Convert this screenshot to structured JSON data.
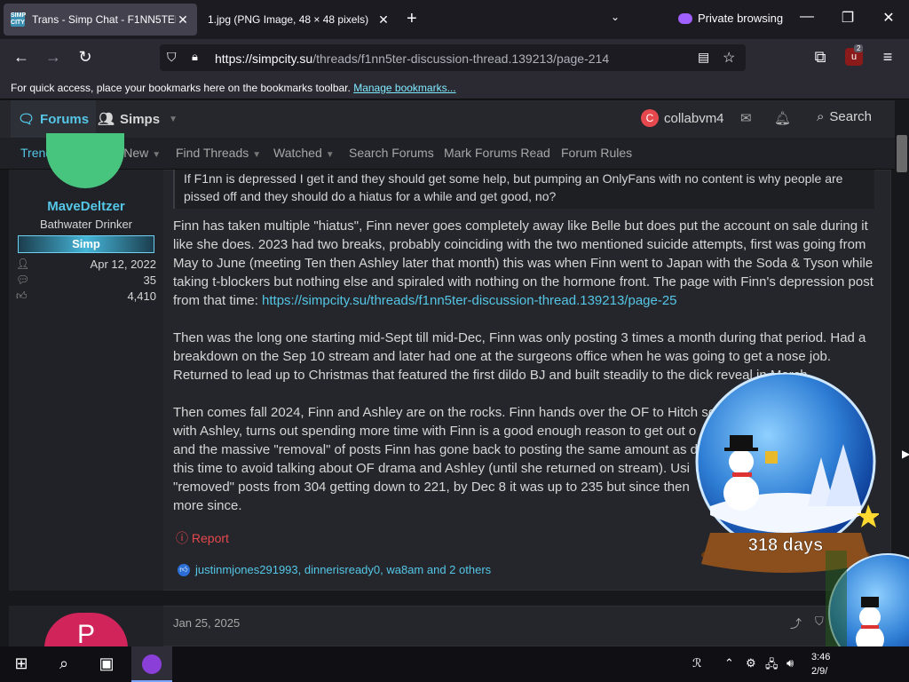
{
  "colors": {
    "accent": "#55c6e6",
    "report": "#e5484d",
    "private": "#a060ff"
  },
  "browser": {
    "tabs": [
      {
        "title": "Trans - Simp Chat - F1NN5TER",
        "favicon": "simpcity-favicon",
        "active": true
      },
      {
        "title": "1.jpg (PNG Image, 48 × 48 pixels)",
        "favicon": "image-favicon",
        "active": false
      }
    ],
    "new_tab": "+",
    "private_label": "Private browsing",
    "url": {
      "host": "https://simpcity.su",
      "path": "/threads/f1nn5ter-discussion-thread.139213/page-214"
    },
    "extension_badge": "2",
    "bookmarks_text": "For quick access, place your bookmarks here on the bookmarks toolbar.",
    "bookmarks_link": "Manage bookmarks..."
  },
  "site": {
    "forums_label": "Forums",
    "simps_label": "Simps",
    "user_initial": "C",
    "username": "collabvm4",
    "search_label": "Search",
    "subnav": [
      {
        "label": "Trending",
        "caret": false
      },
      {
        "label": "What's New",
        "caret": true
      },
      {
        "label": "Find Threads",
        "caret": true
      },
      {
        "label": "Watched",
        "caret": true
      },
      {
        "label": "Search Forums",
        "caret": false
      },
      {
        "label": "Mark Forums Read",
        "caret": false
      },
      {
        "label": "Forum Rules",
        "caret": false
      }
    ]
  },
  "post": {
    "author": "MaveDeltzer",
    "author_title": "Bathwater Drinker",
    "banner": "Simp",
    "joined": "Apr 12, 2022",
    "messages": "35",
    "reactions": "4,410",
    "quote": "If F1nn is depressed I get it and they should get some help, but pumping an OnlyFans with no content is why people are pissed off and they should do a hiatus for a while and get good, no?",
    "p1": "Finn has taken multiple \"hiatus\", Finn never goes completely away like Belle but does put the account on sale during it like she does. 2023 had two breaks, probably coinciding with the two mentioned suicide attempts, first was going from May to June (meeting Ten then Ashley later that month) this was when Finn went to Japan with the Soda & Tyson while taking t-blockers but nothing else and spiraled with nothing on the hormone front. The page with Finn's depression post from that time: ",
    "p1_link": "https://simpcity.su/threads/f1nn5ter-discussion-thread.139213/page-25",
    "p2": "Then was the long one starting mid-Sept till mid-Dec, Finn was only posting 3 times a month during that period. Had a breakdown on the Sep 10 stream and later had one at the surgeons office when he was going to get a nose job. Returned to lead up to Christmas that featured the first dildo BJ and built steadily to the dick reveal in March.",
    "p3_lines": [
      "Then comes fall 2024, Finn and Ashley are on the rocks. Finn hands over the OF to Hitch so h",
      "with Ashley, turns out spending more time with Finn is a good enough reason to get out o",
      "and the massive \"removal\" of posts Finn has gone back to posting the same amount as d",
      "this time to avoid talking about OF drama and Ashley (until she returned on stream). Usi",
      "\"removed\" posts from 304 getting down to 221, by Dec 8 it was up to 235 but since then",
      "more since."
    ],
    "report_label": "Report",
    "reactors": "justinmjones291993, dinnerisready0, wa8am and 2 others",
    "globe_label": "318 days"
  },
  "post2": {
    "avatar_letter": "P",
    "date": "Jan 25, 2025"
  },
  "taskbar": {
    "time": "3:46",
    "date": "2/9/"
  }
}
